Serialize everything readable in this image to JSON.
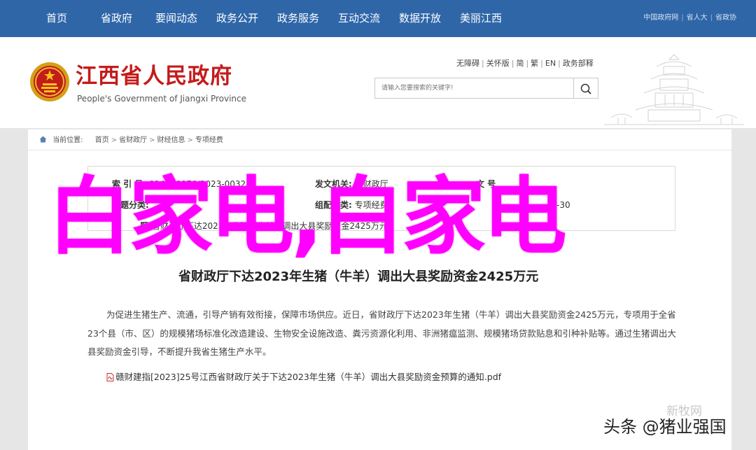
{
  "nav": {
    "items": [
      "首页",
      "省政府",
      "要闻动态",
      "政务公开",
      "政务服务",
      "互动交流",
      "数据开放",
      "美丽江西"
    ],
    "links": [
      "中国政府网",
      "省人大",
      "省政协"
    ]
  },
  "header": {
    "title": "江西省人民政府",
    "subtitle": "People's Government of Jiangxi Province",
    "util_links": [
      "无障碍",
      "关怀版",
      "简",
      "繁",
      "EN",
      "政务部释"
    ],
    "search_placeholder": "请输入您要搜索的关键字!"
  },
  "breadcrumb": {
    "label": "当前位置:",
    "items": [
      "首页",
      "省财政厅",
      "财经信息",
      "专项经费"
    ]
  },
  "meta": {
    "index_label": "索 引 号:",
    "index_value": "014500970/2023-00328",
    "issuer_label": "发文机关:",
    "issuer_value": "省财政厅",
    "docno_label": "文 号",
    "topic_label": "主题分类:",
    "org_label": "组配分类:",
    "org_value": "专项经费",
    "date_fragment": "-30",
    "subject_label": "题:",
    "subject_value": "省财政厅下达2023年生猪（牛羊）调出大县奖励资金2425万元"
  },
  "article": {
    "title": "省财政厅下达2023年生猪（牛羊）调出大县奖励资金2425万元",
    "body": "为促进生猪生产、流通，引导产销有效衔接，保障市场供应。近日，省财政厅下达2023年生猪（牛羊）调出大县奖励资金2425万元，专项用于全省23个县（市、区）的规模猪场标准化改造建设、生物安全设施改造、粪污资源化利用、非洲猪瘟监测、规模猪场贷款贴息和引种补贴等。通过生猪调出大县奖励资金引导，不断提升我省生猪生产水平。",
    "attachment": "赣财建指[2023]25号江西省财政厅关于下达2023年生猪（牛羊）调出大县奖励资金预算的通知.pdf"
  },
  "overlay": {
    "headline": "白家电,白家电",
    "watermark_top": "新牧网",
    "watermark_bottom": "头条 @猪业强国"
  },
  "colors": {
    "nav_bg": "#2e66a8",
    "brand_red": "#c41b1b",
    "overlay_magenta": "#ff00ff",
    "page_bg": "#e6e6e6"
  },
  "icons": [
    "national-emblem-icon",
    "search-icon",
    "home-icon",
    "pdf-icon",
    "pavilion-illustration"
  ]
}
